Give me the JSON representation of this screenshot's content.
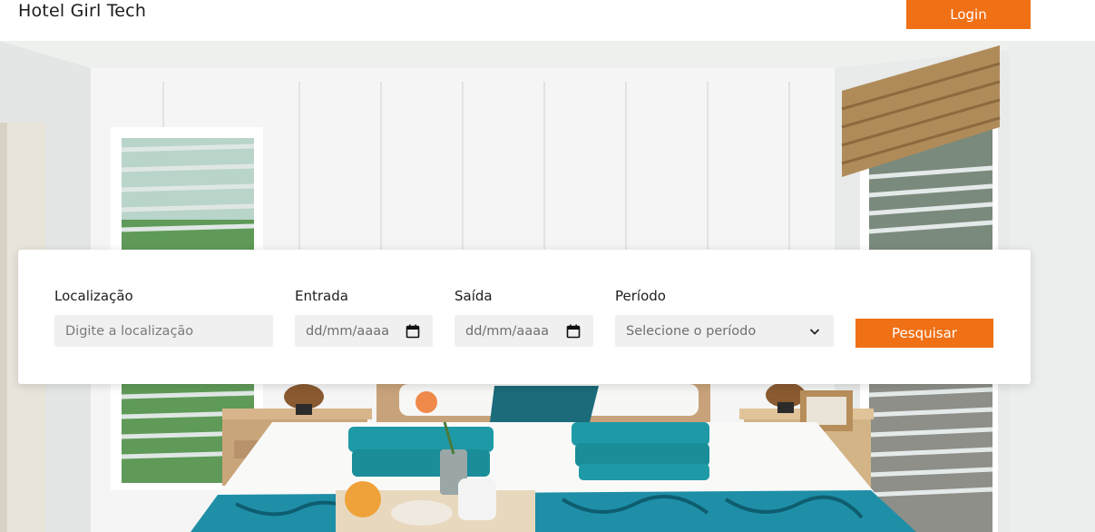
{
  "header": {
    "brand": "Hotel Girl Tech",
    "login_label": "Login"
  },
  "search": {
    "location": {
      "label": "Localização",
      "placeholder": "Digite a localização"
    },
    "checkin": {
      "label": "Entrada",
      "value": "dd/mm/aaaa"
    },
    "checkout": {
      "label": "Saída",
      "value": "dd/mm/aaaa"
    },
    "period": {
      "label": "Período",
      "selected": "Selecione o período"
    },
    "button_label": "Pesquisar"
  },
  "icons": {
    "calendar": "calendar-icon",
    "dropdown": "chevron-down-icon"
  },
  "colors": {
    "accent": "#f07015",
    "towel": "#1e9aa6",
    "bedspread": "#1f8fa8"
  }
}
